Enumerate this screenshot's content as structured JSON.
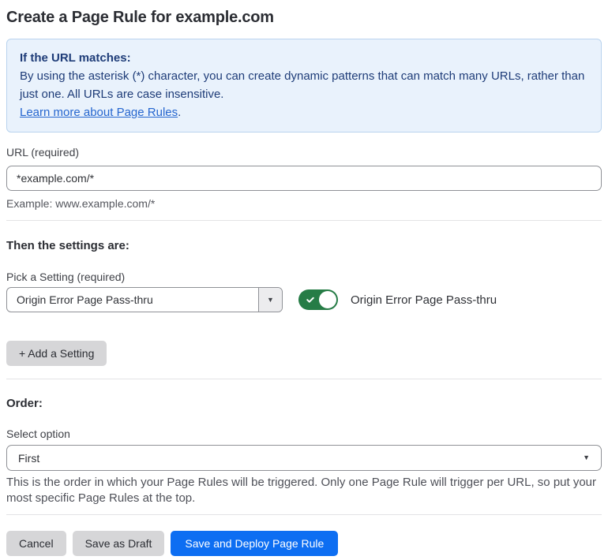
{
  "page": {
    "title": "Create a Page Rule for example.com"
  },
  "info_box": {
    "heading": "If the URL matches:",
    "body": "By using the asterisk (*) character, you can create dynamic patterns that can match many URLs, rather than just one. All URLs are case insensitive.",
    "link_label": "Learn more about Page Rules",
    "link_suffix": "."
  },
  "url_field": {
    "label": "URL (required)",
    "value": "*example.com/*",
    "helper": "Example: www.example.com/*"
  },
  "settings_section": {
    "heading": "Then the settings are:",
    "picker_label": "Pick a Setting (required)",
    "picker_value": "Origin Error Page Pass-thru",
    "toggle_state": "on",
    "toggle_label": "Origin Error Page Pass-thru",
    "add_setting_label": "+ Add a Setting"
  },
  "order_section": {
    "heading": "Order:",
    "select_label": "Select option",
    "select_value": "First",
    "helper": "This is the order in which your Page Rules will be triggered. Only one Page Rule will trigger per URL, so put your most specific Page Rules at the top."
  },
  "footer": {
    "cancel_label": "Cancel",
    "save_draft_label": "Save as Draft",
    "save_deploy_label": "Save and Deploy Page Rule"
  },
  "icons": {
    "chevron_down": "▼",
    "check": "check-icon"
  },
  "colors": {
    "info_bg": "#e9f2fc",
    "info_border": "#b9d3ee",
    "info_text": "#1e3c78",
    "link_blue": "#2566cf",
    "toggle_on_green": "#267c46",
    "primary_button_blue": "#0d6ef2",
    "gray_button": "#d6d6d8",
    "divider": "#e3e3e5"
  }
}
